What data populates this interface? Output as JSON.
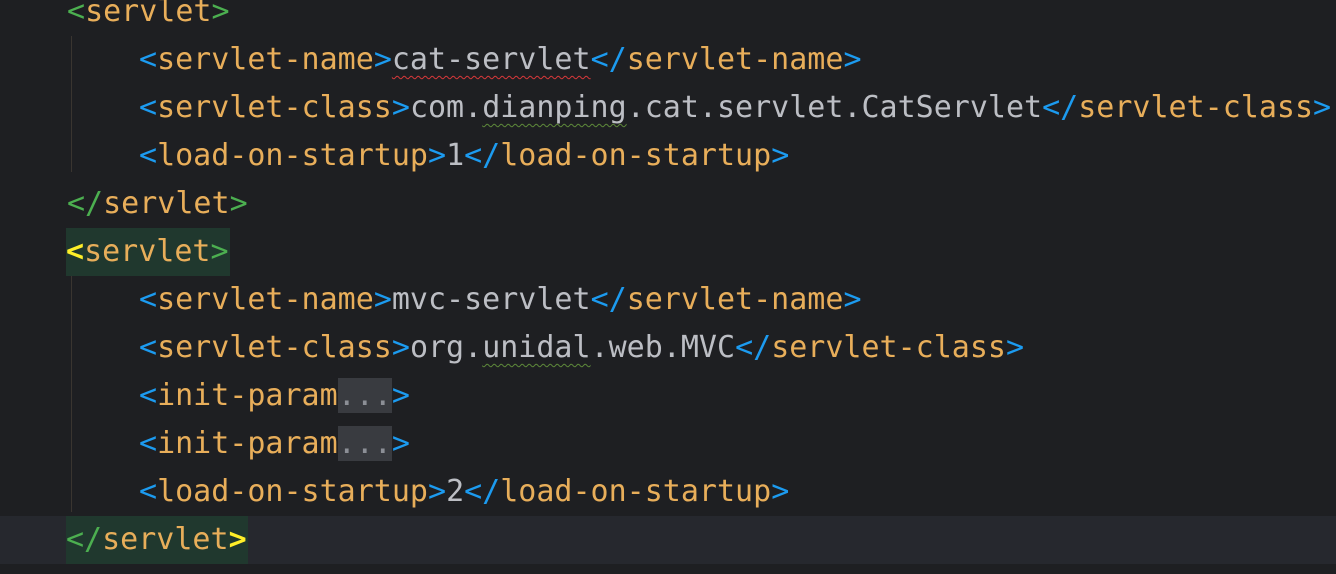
{
  "lines": [
    {
      "open": "<",
      "tag": "servlet",
      "close": ">"
    },
    {
      "tag_open": "servlet-name",
      "value": "cat-servlet",
      "tag_close": "servlet-name"
    },
    {
      "tag_open": "servlet-class",
      "value_a": "com.",
      "value_b": "dianping",
      "value_c": ".cat.servlet.CatServlet",
      "tag_close": "servlet-class"
    },
    {
      "tag_open": "load-on-startup",
      "value": "1",
      "tag_close": "load-on-startup"
    },
    {
      "tag_close": "servlet"
    },
    {
      "tag_open": "servlet"
    },
    {
      "tag_open": "servlet-name",
      "value": "mvc-servlet",
      "tag_close": "servlet-name"
    },
    {
      "tag_open": "servlet-class",
      "value_a": "org.",
      "value_b": "unidal",
      "value_c": ".web.MVC",
      "tag_close": "servlet-class"
    },
    {
      "tag_open": "init-param",
      "folded": "..."
    },
    {
      "tag_open": "init-param",
      "folded": "..."
    },
    {
      "tag_open": "load-on-startup",
      "value": "2",
      "tag_close": "load-on-startup"
    },
    {
      "tag_close": "servlet"
    }
  ],
  "colors": {
    "background": "#1e1f22",
    "tag": "#e8ae5a",
    "bracket": "#1c9bf0",
    "text": "#bcbec4",
    "match_highlight": "#20382e"
  }
}
